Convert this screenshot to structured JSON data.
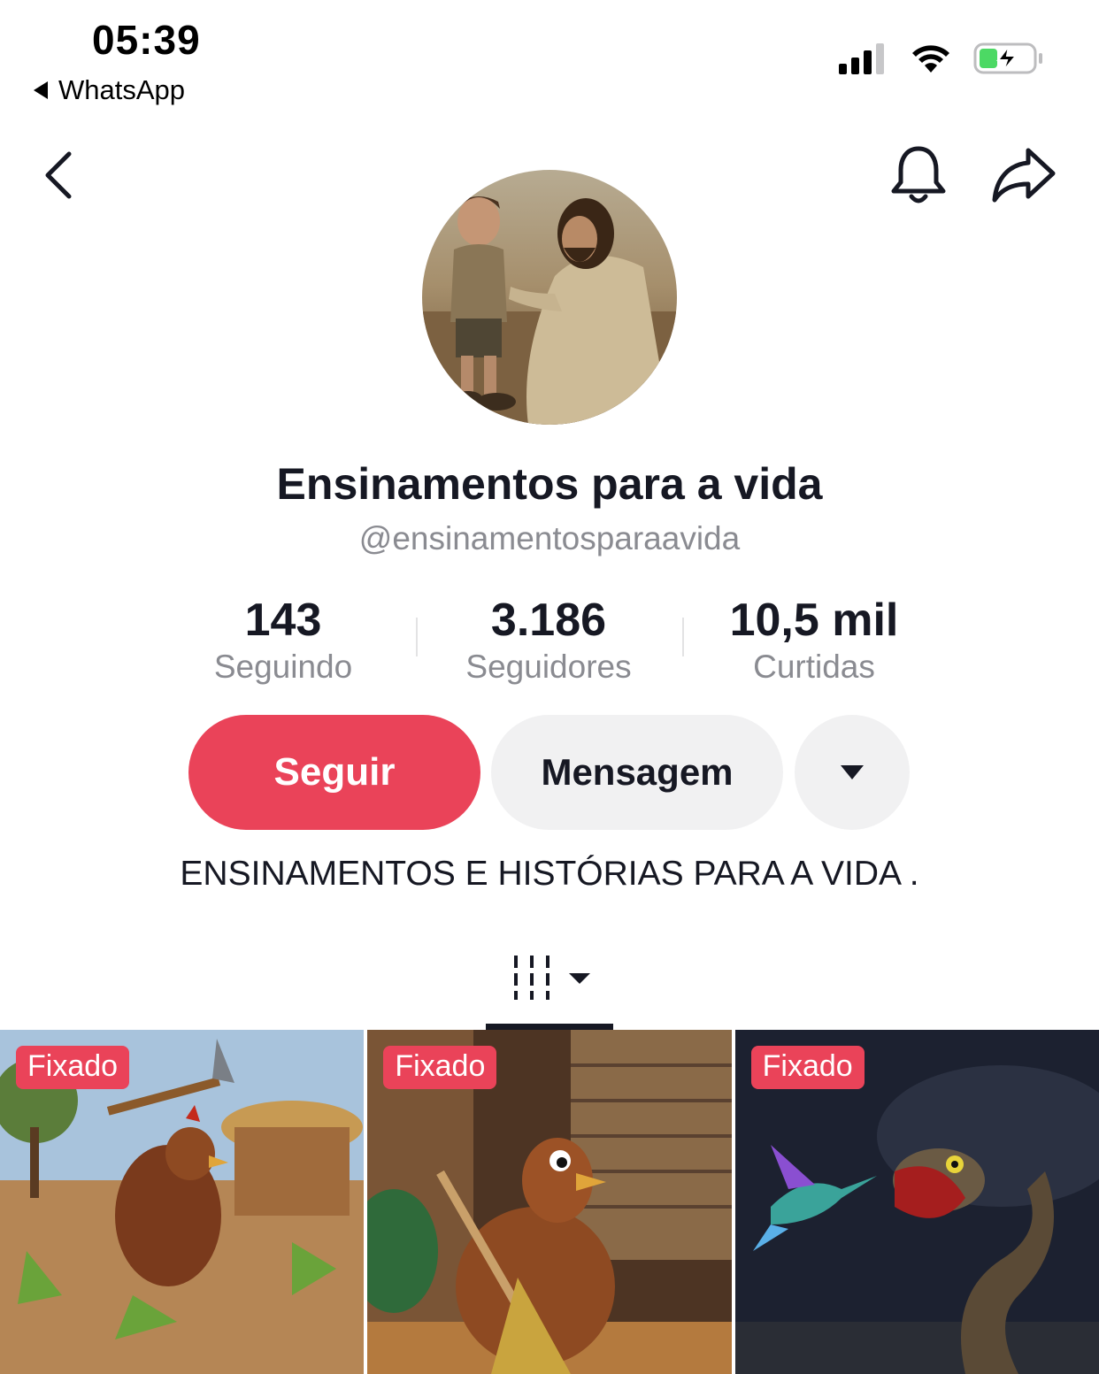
{
  "status_bar": {
    "time": "05:39",
    "back_app": "WhatsApp",
    "icons": [
      "cellular-signal-icon",
      "wifi-icon",
      "battery-charging-icon"
    ]
  },
  "nav": {
    "icons": [
      "chevron-left-icon",
      "bell-icon",
      "share-arrow-icon"
    ]
  },
  "profile": {
    "name": "Ensinamentos para a vida",
    "handle": "@ensinamentosparaavida",
    "stats": [
      {
        "value": "143",
        "label": "Seguindo"
      },
      {
        "value": "3.186",
        "label": "Seguidores"
      },
      {
        "value": "10,5 mil",
        "label": "Curtidas"
      }
    ],
    "bio": "ENSINAMENTOS E HISTÓRIAS PARA A VIDA ."
  },
  "actions": {
    "follow": "Seguir",
    "message": "Mensagem",
    "more_icon": "caret-down-icon"
  },
  "tabs": {
    "active_icon": "grid-lines-icon"
  },
  "videos": [
    {
      "badge": "Fixado"
    },
    {
      "badge": "Fixado"
    },
    {
      "badge": "Fixado"
    }
  ],
  "colors": {
    "accent": "#ea4359",
    "text": "#161823",
    "muted": "#8a8b91",
    "button_secondary": "#f1f1f2"
  }
}
